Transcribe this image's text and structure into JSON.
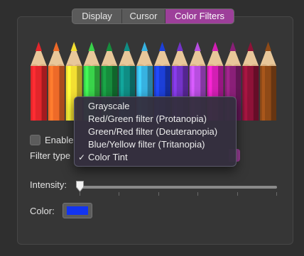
{
  "tabs": [
    {
      "label": "Display",
      "active": false
    },
    {
      "label": "Cursor",
      "active": false
    },
    {
      "label": "Color Filters",
      "active": true
    }
  ],
  "pencil_colors": [
    "#e3262b",
    "#ee6a28",
    "#f3df32",
    "#39d34a",
    "#168c3c",
    "#0f8d84",
    "#37b2e1",
    "#1c3fd8",
    "#7433c8",
    "#b84ee0",
    "#d31fb4",
    "#8a1f78",
    "#8e1238",
    "#8f4a17"
  ],
  "enable_label": "Enable",
  "enable_checked": false,
  "filter_type_label": "Filter type",
  "filter_menu": {
    "items": [
      {
        "label": "Grayscale",
        "checked": false
      },
      {
        "label": "Red/Green filter (Protanopia)",
        "checked": false
      },
      {
        "label": "Green/Red filter (Deuteranopia)",
        "checked": false
      },
      {
        "label": "Blue/Yellow filter (Tritanopia)",
        "checked": false
      },
      {
        "label": "Color Tint",
        "checked": true
      }
    ],
    "check_glyph": "✓"
  },
  "intensity_label": "Intensity:",
  "intensity_value": 0,
  "color_label": "Color:",
  "tint_color": "#1234f0",
  "accent_color": "#9d3f9a"
}
